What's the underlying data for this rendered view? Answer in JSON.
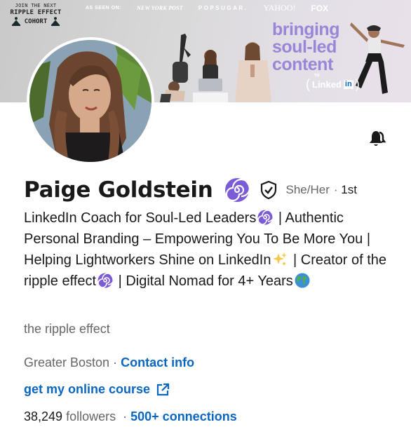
{
  "banner": {
    "cohort_line1": "JOIN THE NEXT",
    "cohort_line2": "RIPPLE EFFECT",
    "cohort_line3": "COHORT",
    "as_seen_on": "AS SEEN ON:",
    "press": [
      "NEW YORK POST",
      "POPSUGAR.",
      "YAHOO!",
      "FOX"
    ],
    "headline_lines": [
      "bringing",
      "soul-led",
      "content"
    ],
    "to_label": "TO",
    "linkedin_word": "Linked",
    "linkedin_in": "in",
    "headline_color": "#9a86d6"
  },
  "profile": {
    "name": "Paige Goldstein",
    "name_badge_icon": "spiral-emoji",
    "verified_icon": "shield-check-icon",
    "pronouns": "She/Her",
    "separator": "·",
    "degree": "1st",
    "headline_parts": {
      "p1": "LinkedIn Coach for Soul-Led Leaders",
      "p2": " | Authentic Personal Branding – Empowering You To Be More You | Helping Lightworkers Shine on LinkedIn",
      "p3": " | Creator of the ripple effect",
      "p4": " | Digital Nomad for 4+ Years"
    },
    "company": "the ripple effect",
    "location": "Greater Boston",
    "contact_info": "Contact info",
    "website": "get my online course",
    "followers_count": "38,249",
    "followers_label": "followers",
    "connections": "500+ connections"
  },
  "colors": {
    "link": "#0a66c2",
    "muted": "#666666",
    "text": "#000000e6"
  }
}
